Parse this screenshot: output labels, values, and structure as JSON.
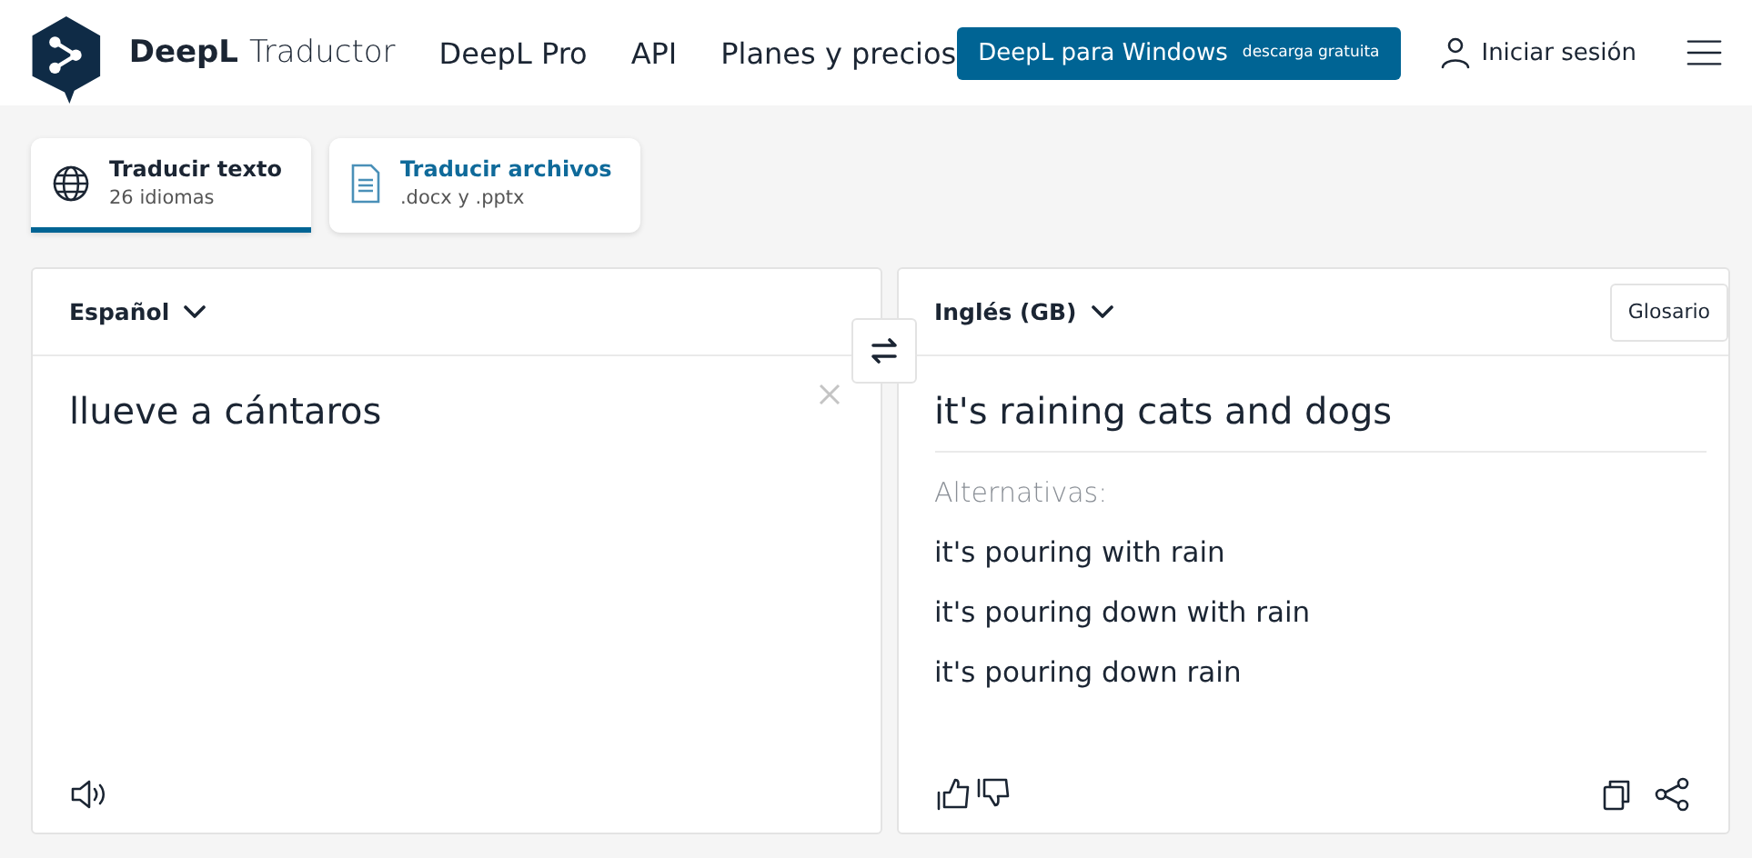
{
  "header": {
    "brand": "DeepL",
    "product": "Traductor",
    "nav": [
      "DeepL Pro",
      "API",
      "Planes y precios"
    ],
    "download_button": {
      "label": "DeepL para Windows",
      "sublabel": "descarga gratuita"
    },
    "login": "Iniciar sesión"
  },
  "tabs": [
    {
      "title": "Traducir texto",
      "subtitle": "26 idiomas",
      "kind": "globe",
      "selected": true
    },
    {
      "title": "Traducir archivos",
      "subtitle": ".docx y .pptx",
      "kind": "document",
      "selected": false
    }
  ],
  "source": {
    "language": "Español",
    "text": "llueve a cántaros"
  },
  "target": {
    "language": "Inglés (GB)",
    "glossary": "Glosario",
    "translation": "it's raining cats and dogs",
    "alternatives_label": "Alternativas:",
    "alternatives": [
      "it's pouring with rain",
      "it's pouring down with rain",
      "it's pouring down rain"
    ]
  }
}
